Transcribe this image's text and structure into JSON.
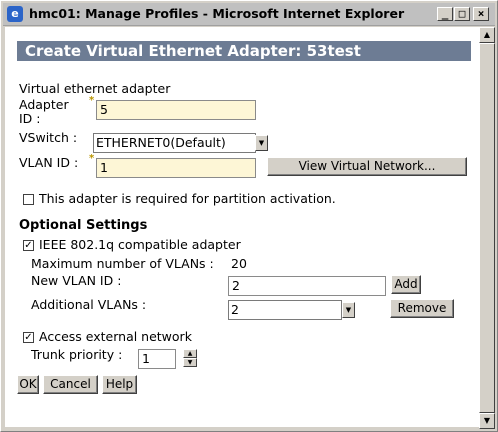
{
  "window": {
    "title": "hmc01: Manage Profiles - Microsoft Internet Explorer",
    "minimize": "_",
    "maximize": "□",
    "close": "×",
    "icon": "ie-icon"
  },
  "page": {
    "header": "Create Virtual Ethernet Adapter: 53test"
  },
  "form": {
    "section_label": "Virtual ethernet adapter",
    "adapter_id_label": "Adapter ID :",
    "adapter_id_value": "5",
    "vswitch_label": "VSwitch :",
    "vswitch_value": "ETHERNET0(Default)",
    "vlan_id_label": "VLAN ID :",
    "vlan_id_value": "1",
    "view_network_button": "View Virtual Network...",
    "required_checkbox_label": "This adapter is required for partition activation.",
    "required_checked": false
  },
  "optional": {
    "heading": "Optional Settings",
    "ieee_label": "IEEE 802.1q compatible adapter",
    "ieee_checked": true,
    "max_vlans_label": "Maximum number of VLANs :",
    "max_vlans_value": "20",
    "new_vlan_label": "New VLAN ID :",
    "new_vlan_value": "2",
    "add_button": "Add",
    "additional_vlans_label": "Additional VLANs :",
    "additional_vlans_value": "2",
    "remove_button": "Remove",
    "access_external_label": "Access external network",
    "access_external_checked": true,
    "trunk_priority_label": "Trunk priority :",
    "trunk_priority_value": "1"
  },
  "buttons": {
    "ok": "OK",
    "cancel": "Cancel",
    "help": "Help"
  },
  "colors": {
    "header_bg": "#6d7c94",
    "required_field_bg": "#fdf6d6",
    "required_marker": "#b89400"
  }
}
